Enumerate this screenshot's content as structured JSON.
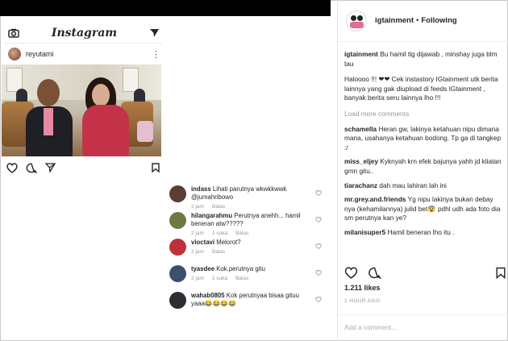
{
  "left_post": {
    "app_title": "Instagram",
    "username": "reyutami"
  },
  "thread": [
    {
      "user": "indass",
      "text": "Lihati parutnya wkwkkwwk @jumahribowo",
      "time": "2 jam",
      "likes": "",
      "reply": "Balas",
      "avatar": "#5a3d33"
    },
    {
      "user": "hilangarahmu",
      "text": "Perutnya anehh... hamil beneran atw?????",
      "time": "2 jam",
      "likes": "1 suka",
      "reply": "Balas",
      "avatar": "#6d7a44"
    },
    {
      "user": "vioctavi",
      "text": "Melorot?",
      "time": "2 jam",
      "likes": "",
      "reply": "Balas",
      "avatar": "#c0303c"
    },
    {
      "user": "tyasdee",
      "text": "Kok.perutnya gitu",
      "time": "2 jam",
      "likes": "1 suka",
      "reply": "Balas",
      "avatar": "#3c4f6e"
    },
    {
      "user": "wahab0805",
      "text": "Kok perutnyaa bisaa gituu yaaa😂😂😂😂",
      "time": "",
      "likes": "",
      "reply": "",
      "avatar": "#2c2c33"
    }
  ],
  "right_panel": {
    "username": "igtainment",
    "separator": "•",
    "follow_label": "Following",
    "caption_user": "igtainment",
    "caption_text": "Bu hamil tlg dijawab , minshay juga blm tau",
    "caption_text2": "Haloooo !!! ❤❤ Cek instastory IGtainment utk berita lainnya yang gak diupload di feeds IGtainment , banyak berita seru lainnya lho !!!",
    "load_more": "Load more comments",
    "comments": [
      {
        "user": "schamella",
        "text": "Heran gw, lakinya ketahuan nipu dimana mana, usahanya ketahuan bodong. Tp ga di tangkep :/"
      },
      {
        "user": "miss_eljey",
        "text": "Kyknyah krn efek bajunya yahh jd kliatan gmn gitu.."
      },
      {
        "user": "tiarachanz",
        "text": "dah mau lahiran lah ini"
      },
      {
        "user": "mr.grey.and.friends",
        "text": "Yg nipu lakinya bukan debay nya (kehamilannya) julid bet😨 pdhl udh ada foto dia sm perutnya kan ye?"
      },
      {
        "user": "milanisuper5",
        "text": "Hamil beneran lho itu ."
      }
    ],
    "likes": "1.211 likes",
    "time_ago": "1 HOUR AGO",
    "add_comment_placeholder": "Add a comment..."
  },
  "icons": [
    "camera-icon",
    "send-icon",
    "heart-icon",
    "comment-icon",
    "bookmark-icon",
    "more-icon"
  ]
}
